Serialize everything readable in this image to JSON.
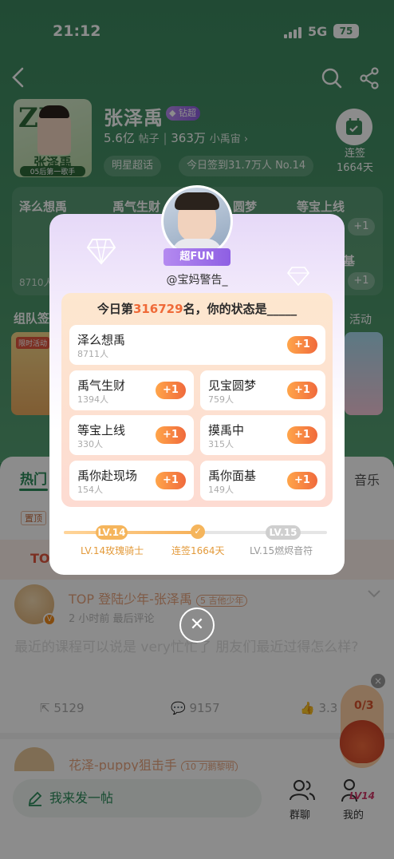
{
  "status": {
    "time": "21:12",
    "network": "5G",
    "battery": "75"
  },
  "group": {
    "title": "张泽禹",
    "level_badge": "钻超",
    "posts_count": "5.6亿",
    "posts_label": "帖子",
    "fans_count": "363万",
    "fans_label": "小禹宙",
    "tags": [
      "明星超话",
      "今日签到31.7万人 No.14"
    ],
    "checkin_label": "连签",
    "checkin_days": "1664天",
    "avatar_text": "张泽禹",
    "avatar_sub": "05后第一歌手"
  },
  "background_cards": {
    "items": [
      {
        "label": "泽么想禹",
        "count": "8710人"
      },
      {
        "label": "禹气生财"
      },
      {
        "label": "圆梦"
      },
      {
        "label": "等宝上线"
      }
    ],
    "partial": "基",
    "plus": "+1",
    "section_title": "组队签",
    "section_right": "活动",
    "activity_tag": "限时活动"
  },
  "feed": {
    "tabs": [
      "热门"
    ],
    "tab_right": "音乐",
    "pin_label": "置顶",
    "top_label": "TOP",
    "post": {
      "user": "TOP 登陆少年-张泽禹",
      "user_badge": "吉他少年",
      "user_level": "5",
      "time": "2 小时前 最后评论",
      "body": "最近的课程可以说是 very忙忙了 朋友们最近过得怎么样?",
      "shares": "5129",
      "comments": "9157",
      "likes": "3.3"
    },
    "next_user": "花泽-puppy狙击手",
    "next_badge": "刀鹅黎明",
    "next_level": "10"
  },
  "bottom": {
    "post_placeholder": "我来发一帖",
    "chat_label": "群聊",
    "mine_label": "我的",
    "level_tag": "LV14"
  },
  "float_widget": {
    "progress": "0/3"
  },
  "modal": {
    "fun_tag": "超FUN",
    "handle": "@宝妈警告_",
    "question_prefix": "今日第",
    "rank": "316729",
    "question_suffix": "名，你的状态是_____",
    "plus": "+1",
    "options": [
      {
        "name": "泽么想禹",
        "count": "8711人"
      },
      {
        "name": "禹气生财",
        "count": "1394人"
      },
      {
        "name": "见宝圆梦",
        "count": "759人"
      },
      {
        "name": "等宝上线",
        "count": "330人"
      },
      {
        "name": "摸禹中",
        "count": "315人"
      },
      {
        "name": "禹你赴现场",
        "count": "154人"
      },
      {
        "name": "禹你面基",
        "count": "149人"
      }
    ],
    "progress": {
      "current_level": "LV.14",
      "current_title": "LV.14玫瑰骑士",
      "streak": "连签1664天",
      "next_level": "LV.15",
      "next_title": "LV.15燃烬音符",
      "fraction": 0.5
    }
  }
}
